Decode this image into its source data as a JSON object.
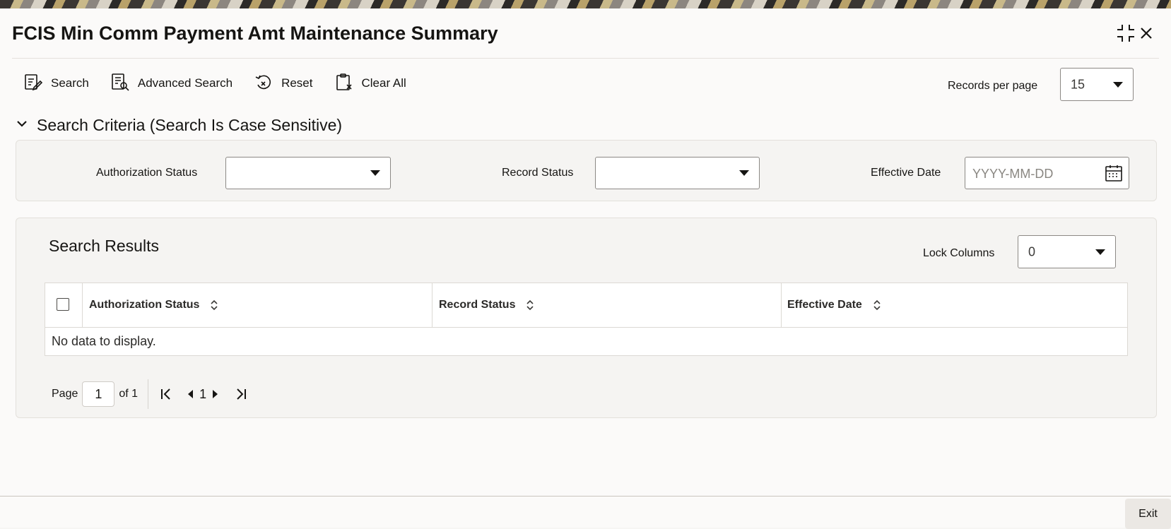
{
  "window": {
    "title": "FCIS Min Comm Payment Amt Maintenance Summary"
  },
  "toolbar": {
    "search_label": "Search",
    "advanced_search_label": "Advanced Search",
    "reset_label": "Reset",
    "clear_all_label": "Clear All",
    "records_per_page_label": "Records per page",
    "records_per_page_value": "15"
  },
  "search_criteria": {
    "heading": "Search Criteria (Search Is Case Sensitive)",
    "authorization_status_label": "Authorization Status",
    "authorization_status_value": "",
    "record_status_label": "Record Status",
    "record_status_value": "",
    "effective_date_label": "Effective Date",
    "effective_date_placeholder": "YYYY-MM-DD"
  },
  "results": {
    "heading": "Search Results",
    "lock_columns_label": "Lock Columns",
    "lock_columns_value": "0",
    "columns": [
      "Authorization Status",
      "Record Status",
      "Effective Date"
    ],
    "empty_message": "No data to display."
  },
  "pagination": {
    "page_label": "Page",
    "current_page": "1",
    "of_label": "of 1",
    "page_indicator": "1"
  },
  "footer": {
    "exit_label": "Exit"
  },
  "icons": {
    "search": "search-icon",
    "advanced_search": "advanced-search-icon",
    "reset": "reset-icon",
    "clear_all": "clear-all-icon",
    "calendar": "calendar-icon",
    "minimize": "minimize-icon",
    "close": "close-icon"
  }
}
